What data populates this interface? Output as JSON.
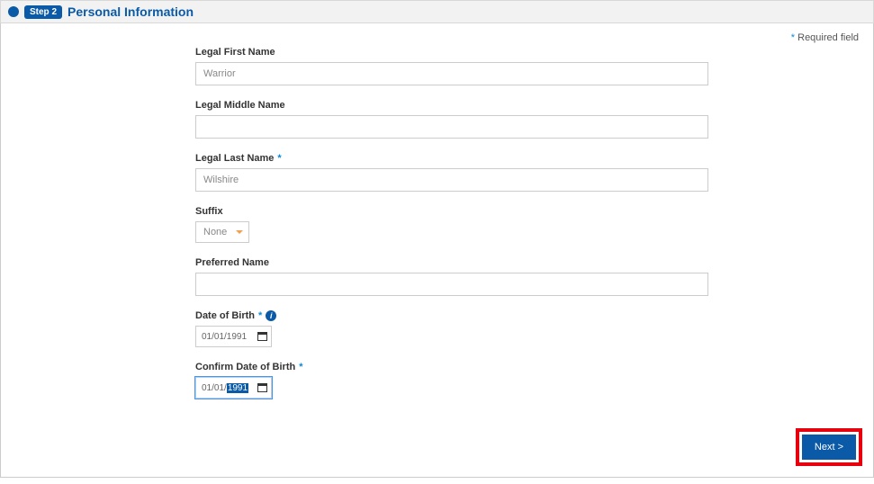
{
  "header": {
    "step_label": "Step 2",
    "title": "Personal Information"
  },
  "required_note": "Required field",
  "fields": {
    "first_name": {
      "label": "Legal First Name",
      "value": "Warrior"
    },
    "middle_name": {
      "label": "Legal Middle Name",
      "value": ""
    },
    "last_name": {
      "label": "Legal Last Name",
      "value": "Wilshire"
    },
    "suffix": {
      "label": "Suffix",
      "selected": "None"
    },
    "preferred_name": {
      "label": "Preferred Name",
      "value": ""
    },
    "dob": {
      "label": "Date of Birth",
      "value": "01/01/1991"
    },
    "confirm_dob": {
      "label": "Confirm Date of Birth",
      "value_prefix": "01/01/",
      "value_highlight": "1991"
    }
  },
  "buttons": {
    "next": "Next >"
  }
}
